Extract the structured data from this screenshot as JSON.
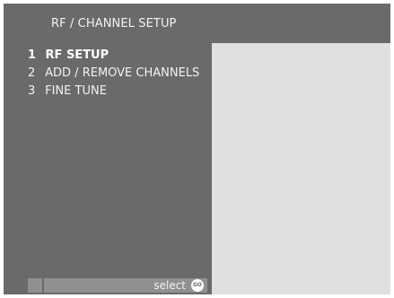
{
  "header": {
    "title": "RF / CHANNEL  SETUP"
  },
  "menu": {
    "items": [
      {
        "number": "1",
        "label": "RF  SETUP",
        "active": true
      },
      {
        "number": "2",
        "label": "ADD / REMOVE CHANNELS",
        "active": false
      },
      {
        "number": "3",
        "label": "FINE  TUNE",
        "active": false
      }
    ]
  },
  "statusbar": {
    "label": "select",
    "icon": "go-icon",
    "icon_text": "GO"
  },
  "colors": {
    "background": "#6a6a6a",
    "panel": "#e0e0e0",
    "statusbar": "#909090",
    "text": "#f2f2f2"
  }
}
